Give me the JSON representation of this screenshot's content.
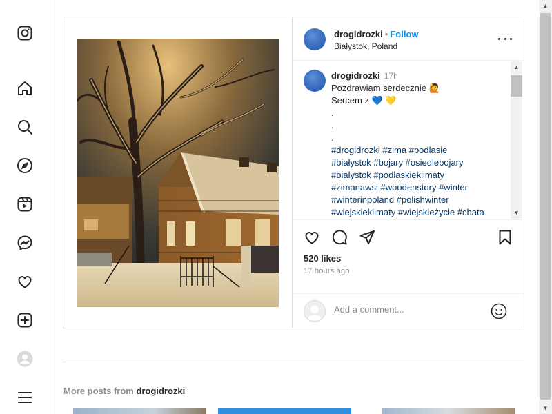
{
  "nav": {
    "items": [
      {
        "icon": "instagram-icon",
        "label": ""
      },
      {
        "icon": "home-icon"
      },
      {
        "icon": "search-icon"
      },
      {
        "icon": "explore-icon"
      },
      {
        "icon": "reels-icon"
      },
      {
        "icon": "messenger-icon"
      },
      {
        "icon": "heart-icon"
      },
      {
        "icon": "create-icon"
      },
      {
        "icon": "profile-icon"
      },
      {
        "icon": "menu-icon"
      }
    ]
  },
  "post": {
    "author": "drogidrozki",
    "separator": "•",
    "follow_label": "Follow",
    "location": "Białystok, Poland",
    "caption": {
      "author": "drogidrozki",
      "time": "17h",
      "lines": [
        "Pozdrawiam serdecznie 🙋",
        "Sercem z 💙 💛",
        ".",
        ".",
        "."
      ],
      "hashtag_lines": [
        "#drogidrozki #zima #podlasie",
        "#białystok #bojary #osiedlebojary",
        "#bialystok #podlaskieklimaty",
        "#zimanawsi #woodenstory #winter",
        "#winterinpoland #polishwinter",
        "#wiejskieklimaty #wiejskieżycie #chata"
      ]
    },
    "likes": "520 likes",
    "time_ago": "17 hours ago",
    "comment_placeholder": "Add a comment..."
  },
  "more_posts": {
    "prefix": "More posts from",
    "author": "drogidrozki"
  },
  "colors": {
    "accent": "#0095f6",
    "hashtag": "#00376b",
    "border": "#dbdbdb",
    "muted": "#8e8e8e"
  }
}
